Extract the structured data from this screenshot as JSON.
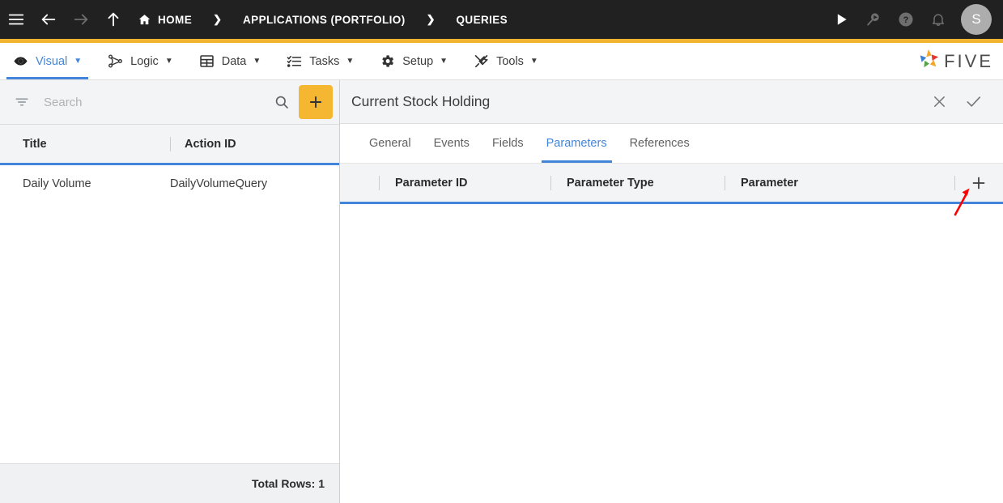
{
  "topbar": {
    "menu_icon": "hamburger-menu-icon",
    "back_icon": "arrow-left-icon",
    "forward_icon": "arrow-right-icon",
    "up_icon": "arrow-up-icon",
    "breadcrumbs": [
      {
        "label": "HOME",
        "icon": "home-icon"
      },
      {
        "label": "APPLICATIONS (PORTFOLIO)",
        "icon": ""
      },
      {
        "label": "QUERIES",
        "icon": ""
      }
    ],
    "separator": "❯",
    "actions": [
      {
        "name": "run-icon",
        "glyph": "play"
      },
      {
        "name": "search-run-icon",
        "glyph": "search-play"
      },
      {
        "name": "help-icon",
        "glyph": "question"
      },
      {
        "name": "notifications-icon",
        "glyph": "bell"
      }
    ],
    "avatar_initial": "S"
  },
  "menubar": {
    "items": [
      {
        "label": "Visual",
        "icon": "eye-icon",
        "active": true
      },
      {
        "label": "Logic",
        "icon": "logic-nodes-icon",
        "active": false
      },
      {
        "label": "Data",
        "icon": "table-grid-icon",
        "active": false
      },
      {
        "label": "Tasks",
        "icon": "checklist-icon",
        "active": false
      },
      {
        "label": "Setup",
        "icon": "gear-icon",
        "active": false
      },
      {
        "label": "Tools",
        "icon": "tools-icon",
        "active": false
      }
    ],
    "caret": "▼",
    "logo_text": "FIVE"
  },
  "left_panel": {
    "search": {
      "placeholder": "Search",
      "value": "",
      "filter_icon": "filter-icon",
      "search_icon": "search-icon",
      "add_label": "+"
    },
    "columns": [
      "Title",
      "Action ID"
    ],
    "rows": [
      {
        "title": "Daily Volume",
        "action_id": "DailyVolumeQuery"
      }
    ],
    "footer": "Total Rows: 1"
  },
  "right_panel": {
    "title": "Current Stock Holding",
    "close_icon": "close-icon",
    "confirm_icon": "check-icon",
    "tabs": [
      {
        "label": "General",
        "active": false
      },
      {
        "label": "Events",
        "active": false
      },
      {
        "label": "Fields",
        "active": false
      },
      {
        "label": "Parameters",
        "active": true
      },
      {
        "label": "References",
        "active": false
      }
    ],
    "parameters_table": {
      "columns": [
        "Parameter ID",
        "Parameter Type",
        "Parameter"
      ],
      "add_label": "+",
      "rows": []
    }
  },
  "annotation": {
    "arrow_color": "#ff0000",
    "points_to": "add-parameter-button"
  },
  "colors": {
    "topbar_bg": "#212121",
    "accent_orange": "#f2b430",
    "accent_blue": "#4285da",
    "panel_grey": "#f2f4f5",
    "add_button": "#f5b731"
  }
}
